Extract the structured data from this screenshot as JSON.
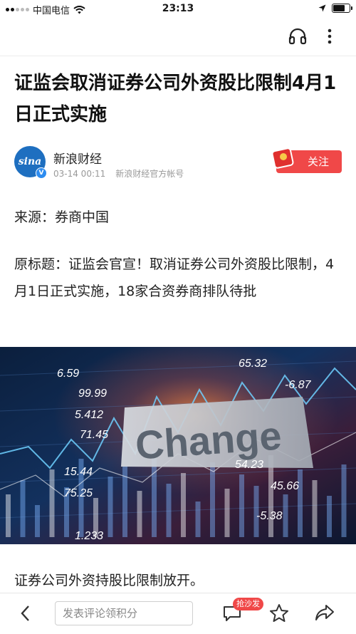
{
  "status_bar": {
    "carrier": "中国电信",
    "time": "23:13",
    "battery_level": 0.8
  },
  "article": {
    "title": "证监会取消证券公司外资股比限制4月1日正式实施",
    "author": {
      "avatar_text": "sina",
      "name": "新浪财经",
      "date": "03-14 00:11",
      "account_type": "新浪财经官方帐号",
      "follow_label": "关注"
    },
    "paragraphs": [
      "来源：券商中国",
      "原标题：证监会官宣！取消证券公司外资股比限制，4月1日正式实施，18家合资券商排队待批",
      "证券公司外资持股比限制放开。"
    ],
    "hero_image": {
      "main_text": "Change",
      "numbers": [
        "6.59",
        "99.99",
        "5.412",
        "71.45",
        "15.44",
        "75.25",
        "1.233",
        "65.32",
        "-6.87",
        "54.23",
        "45.66",
        "-5.38"
      ]
    }
  },
  "bottom_bar": {
    "comment_placeholder": "发表评论领积分",
    "sofa_badge": "抢沙发"
  },
  "colors": {
    "accent": "#f04848",
    "brand_blue": "#1e6fc0"
  },
  "icons": {
    "status": [
      "signal-icon",
      "wifi-icon",
      "location-icon",
      "battery-icon"
    ],
    "topbar": [
      "headphones-icon",
      "more-icon"
    ],
    "bottom": [
      "back-icon",
      "comment-icon",
      "star-icon",
      "share-icon"
    ]
  }
}
